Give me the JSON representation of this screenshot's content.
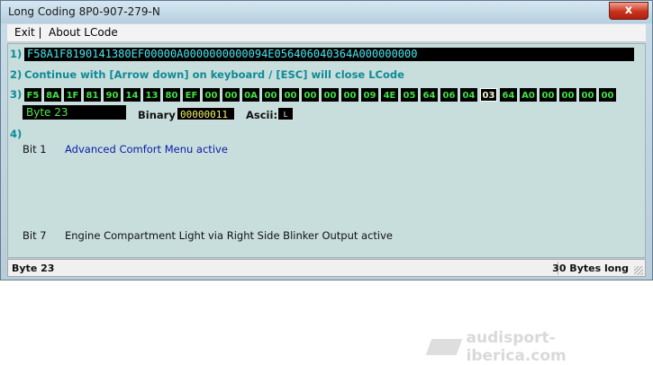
{
  "window": {
    "title": "Long Coding  8P0-907-279-N",
    "close_glyph": "x"
  },
  "menu": {
    "exit": "Exit |",
    "about": "About LCode"
  },
  "steps": {
    "s1": "1)",
    "s2": "2)",
    "s3": "3)",
    "s4": "4)",
    "code": "F58A1F8190141380EF00000A0000000000094E056406040364A000000000",
    "hint": "Continue with [Arrow down] on keyboard / [ESC] will close LCode"
  },
  "bytes": [
    "F5",
    "8A",
    "1F",
    "81",
    "90",
    "14",
    "13",
    "80",
    "EF",
    "00",
    "00",
    "0A",
    "00",
    "00",
    "00",
    "00",
    "00",
    "09",
    "4E",
    "05",
    "64",
    "06",
    "04",
    "03",
    "64",
    "A0",
    "00",
    "00",
    "00",
    "00"
  ],
  "selected_byte_index": 23,
  "byte_panel": {
    "label": "Byte 23",
    "binary_label": "Binary:",
    "binary_value": "00000011",
    "ascii_label": "Ascii:",
    "ascii_value": "L"
  },
  "bits": [
    {
      "num": "Bit 1",
      "desc": "Advanced Comfort Menu active",
      "color": "#0b1aa8"
    },
    {
      "num": "Bit 7",
      "desc": "Engine Compartment Light via Right Side Blinker Output active",
      "color": "#111111"
    }
  ],
  "status": {
    "left": "Byte 23",
    "right": "30 Bytes long"
  },
  "watermark": {
    "text": "audisport-iberica.com"
  }
}
